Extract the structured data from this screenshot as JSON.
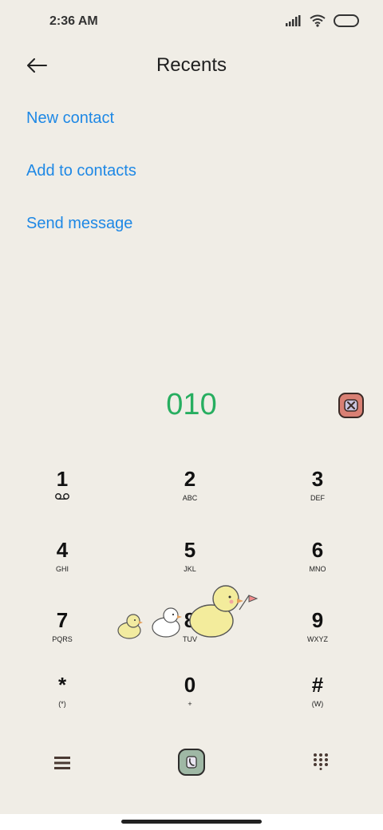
{
  "status": {
    "time": "2:36 AM"
  },
  "header": {
    "title": "Recents"
  },
  "options": {
    "new_contact": "New contact",
    "add_to_contacts": "Add to contacts",
    "send_message": "Send message"
  },
  "dialer": {
    "number": "010"
  },
  "keypad": [
    {
      "digit": "1",
      "letters": ""
    },
    {
      "digit": "2",
      "letters": "ABC"
    },
    {
      "digit": "3",
      "letters": "DEF"
    },
    {
      "digit": "4",
      "letters": "GHI"
    },
    {
      "digit": "5",
      "letters": "JKL"
    },
    {
      "digit": "6",
      "letters": "MNO"
    },
    {
      "digit": "7",
      "letters": "PQRS"
    },
    {
      "digit": "8",
      "letters": "TUV"
    },
    {
      "digit": "9",
      "letters": "WXYZ"
    },
    {
      "digit": "*",
      "letters": "(*)"
    },
    {
      "digit": "0",
      "letters": "+"
    },
    {
      "digit": "#",
      "letters": "(W)"
    }
  ],
  "icons": {
    "back": "back-arrow-icon",
    "delete": "delete-icon",
    "voicemail": "voicemail-icon",
    "menu": "menu-icon",
    "call": "phone-icon",
    "keypad": "dialpad-icon"
  },
  "colors": {
    "background": "#f0ede6",
    "link": "#1e88e5",
    "number": "#27ae60",
    "delete_bg": "#d98074",
    "call_bg": "#9fb8a5"
  }
}
